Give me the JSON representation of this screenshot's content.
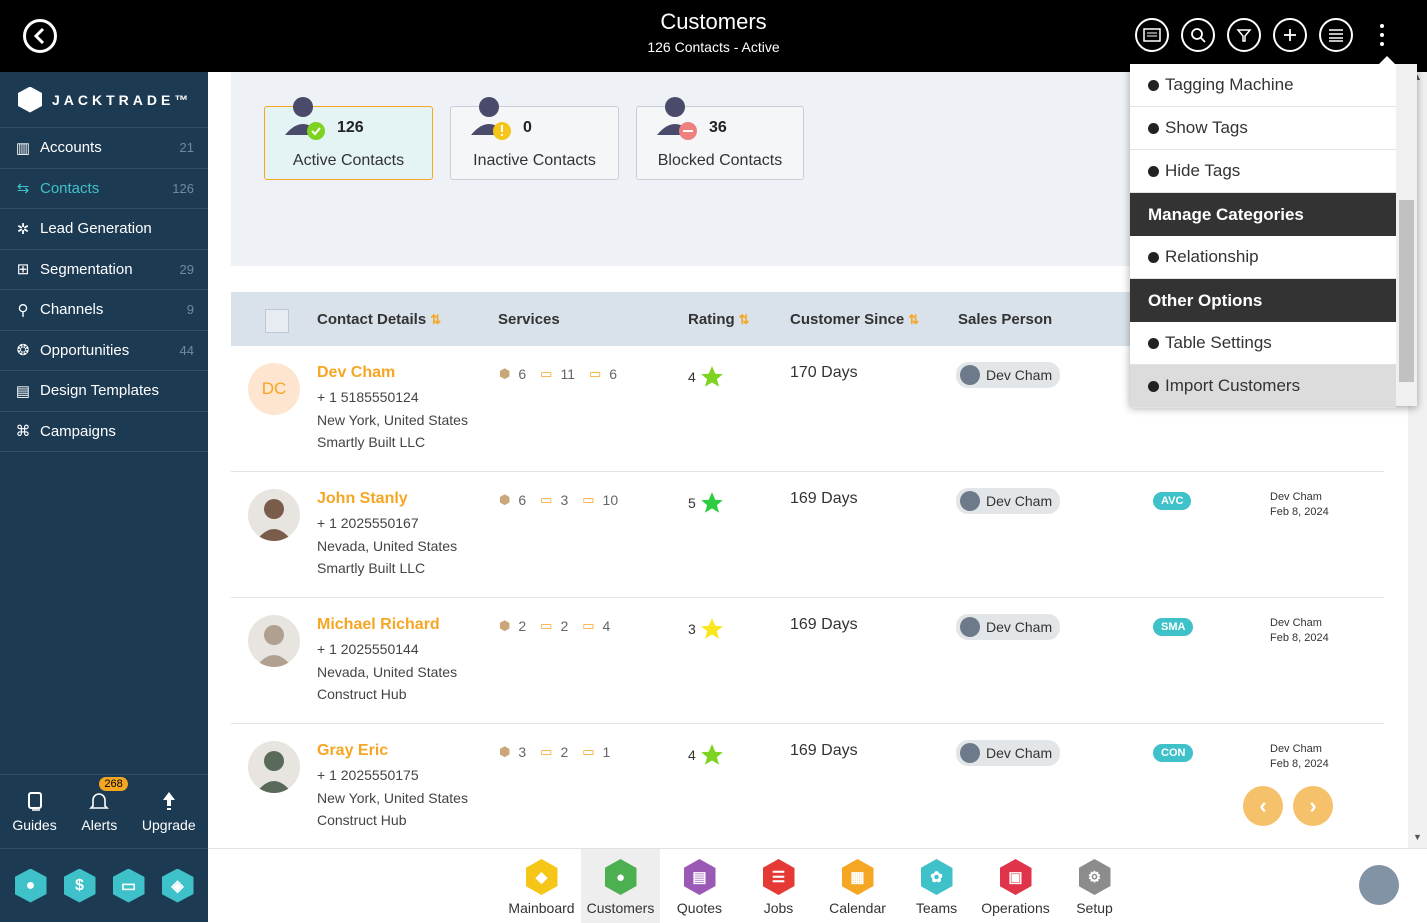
{
  "header": {
    "title": "Customers",
    "subtitle": "126 Contacts - Active",
    "icons": [
      "vcard-icon",
      "search-icon",
      "filter-icon",
      "add-icon",
      "list-icon",
      "more-icon"
    ]
  },
  "sidebar": {
    "brand": "JACKTRADE™",
    "items": [
      {
        "label": "Accounts",
        "count": "21",
        "icon": "accounts-icon"
      },
      {
        "label": "Contacts",
        "count": "126",
        "icon": "contacts-icon"
      },
      {
        "label": "Lead Generation",
        "count": "",
        "icon": "lead-icon"
      },
      {
        "label": "Segmentation",
        "count": "29",
        "icon": "segmentation-icon"
      },
      {
        "label": "Channels",
        "count": "9",
        "icon": "channels-icon"
      },
      {
        "label": "Opportunities",
        "count": "44",
        "icon": "opportunities-icon"
      },
      {
        "label": "Design Templates",
        "count": "",
        "icon": "templates-icon"
      },
      {
        "label": "Campaigns",
        "count": "",
        "icon": "campaigns-icon"
      }
    ],
    "bottom": {
      "guides": "Guides",
      "alerts": "Alerts",
      "alerts_count": "268",
      "upgrade": "Upgrade"
    },
    "hex_icons": [
      "person-icon",
      "dollar-icon",
      "money-icon",
      "hand-icon"
    ]
  },
  "summary": {
    "active": {
      "count": "126",
      "label": "Active Contacts"
    },
    "inactive": {
      "count": "0",
      "label": "Inactive Contacts"
    },
    "blocked": {
      "count": "36",
      "label": "Blocked Contacts"
    }
  },
  "table": {
    "headers": {
      "contact": "Contact Details",
      "services": "Services",
      "rating": "Rating",
      "since": "Customer Since",
      "sales": "Sales Person"
    },
    "rows": [
      {
        "initials": "DC",
        "name": "Dev Cham",
        "phone": "+ 1 5185550124",
        "location": "New York, United States",
        "company": "Smartly Built LLC",
        "s1": "6",
        "s2": "11",
        "s3": "6",
        "rating": "4",
        "star_color": "#7ed321",
        "since": "170 Days",
        "sales": "Dev Cham",
        "tag": "",
        "upd_by": "",
        "upd_date": ""
      },
      {
        "initials": "",
        "name": "John Stanly",
        "phone": "+ 1 2025550167",
        "location": "Nevada, United States",
        "company": "Smartly Built LLC",
        "s1": "6",
        "s2": "3",
        "s3": "10",
        "rating": "5",
        "star_color": "#2ecc40",
        "since": "169 Days",
        "sales": "Dev Cham",
        "tag": "AVC",
        "upd_by": "Dev Cham",
        "upd_date": "Feb 8, 2024"
      },
      {
        "initials": "",
        "name": "Michael Richard",
        "phone": "+ 1 2025550144",
        "location": "Nevada, United States",
        "company": "Construct Hub",
        "s1": "2",
        "s2": "2",
        "s3": "4",
        "rating": "3",
        "star_color": "#f8e71c",
        "since": "169 Days",
        "sales": "Dev Cham",
        "tag": "SMA",
        "upd_by": "Dev Cham",
        "upd_date": "Feb 8, 2024"
      },
      {
        "initials": "",
        "name": "Gray Eric",
        "phone": "+ 1 2025550175",
        "location": "New York, United States",
        "company": "Construct Hub",
        "s1": "3",
        "s2": "2",
        "s3": "1",
        "rating": "4",
        "star_color": "#7ed321",
        "since": "169 Days",
        "sales": "Dev Cham",
        "tag": "CON",
        "upd_by": "Dev Cham",
        "upd_date": "Feb 8, 2024"
      }
    ]
  },
  "dropdown": {
    "items": [
      {
        "type": "item",
        "label": "Tagging Machine"
      },
      {
        "type": "item",
        "label": "Show Tags"
      },
      {
        "type": "item",
        "label": "Hide Tags"
      },
      {
        "type": "header",
        "label": "Manage Categories"
      },
      {
        "type": "item",
        "label": "Relationship"
      },
      {
        "type": "header",
        "label": "Other Options"
      },
      {
        "type": "item",
        "label": "Table Settings"
      },
      {
        "type": "item",
        "label": "Import Customers"
      }
    ]
  },
  "bottom_nav": [
    {
      "label": "Mainboard",
      "color": "#f5c518",
      "icon": "mainboard-icon"
    },
    {
      "label": "Customers",
      "color": "#4caf50",
      "icon": "customers-icon"
    },
    {
      "label": "Quotes",
      "color": "#9b59b6",
      "icon": "quotes-icon"
    },
    {
      "label": "Jobs",
      "color": "#e53935",
      "icon": "jobs-icon"
    },
    {
      "label": "Calendar",
      "color": "#f5a623",
      "icon": "calendar-icon"
    },
    {
      "label": "Teams",
      "color": "#3fc1c9",
      "icon": "teams-icon"
    },
    {
      "label": "Operations",
      "color": "#e0344a",
      "icon": "operations-icon"
    },
    {
      "label": "Setup",
      "color": "#8c8c8c",
      "icon": "setup-icon"
    }
  ],
  "colors": {
    "accent": "#f5a623",
    "teal": "#3fc1c9",
    "sidebar": "#1d3a53"
  }
}
